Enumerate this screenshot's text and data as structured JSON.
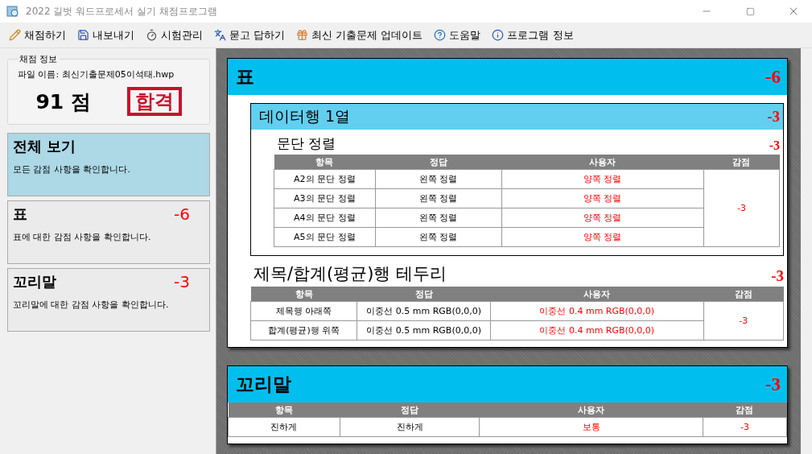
{
  "window": {
    "title": "2022 길벗 워드프로세서 실기 채점프로그램"
  },
  "menu": [
    {
      "label": "채점하기"
    },
    {
      "label": "내보내기"
    },
    {
      "label": "시험관리"
    },
    {
      "label": "묻고 답하기"
    },
    {
      "label": "최신 기출문제 업데이트"
    },
    {
      "label": "도움말"
    },
    {
      "label": "프로그램 정보"
    }
  ],
  "score_info": {
    "title": "채점 정보",
    "file_name": "파일 이름: 최신기출문제05이석태.hwp",
    "score": "91 점",
    "result": "합격"
  },
  "nav": [
    {
      "title": "전체 보기",
      "description": "모든 감점 사항을 확인합니다.",
      "selected": true
    },
    {
      "title": "표",
      "penalty": "-6",
      "description": "표에 대한 감점 사항을 확인합니다.",
      "selected": false
    },
    {
      "title": "꼬리말",
      "penalty": "-3",
      "description": "꼬리말에 대한 감점 사항을 확인합니다.",
      "selected": false
    }
  ],
  "sections": [
    {
      "title": "표",
      "penalty": "-6",
      "children": [
        {
          "kind": "subsection",
          "title": "데이터행 1열",
          "penalty": "-3",
          "children": [
            {
              "kind": "group",
              "title": "문단 정렬",
              "penalty": "-3",
              "table": {
                "columns": [
                  "항목",
                  "정답",
                  "사용자",
                  "감점"
                ],
                "deduction": "-3",
                "rows": [
                  {
                    "item": "A2의 문단 정렬",
                    "answer": "왼쪽 정렬",
                    "user": "양쪽 정렬"
                  },
                  {
                    "item": "A3의 문단 정렬",
                    "answer": "왼쪽 정렬",
                    "user": "양쪽 정렬"
                  },
                  {
                    "item": "A4의 문단 정렬",
                    "answer": "왼쪽 정렬",
                    "user": "양쪽 정렬"
                  },
                  {
                    "item": "A5의 문단 정렬",
                    "answer": "왼쪽 정렬",
                    "user": "양쪽 정렬"
                  }
                ]
              }
            }
          ]
        },
        {
          "kind": "group",
          "title": "제목/합계(평균)행 테두리",
          "penalty": "-3",
          "table": {
            "columns": [
              "항목",
              "정답",
              "사용자",
              "감점"
            ],
            "deduction": "-3",
            "rows": [
              {
                "item": "제목행 아래쪽",
                "answer": "이중선 0.5 mm RGB(0,0,0)",
                "user": "이중선 0.4 mm RGB(0,0,0)"
              },
              {
                "item": "합계(평균)행 위쪽",
                "answer": "이중선 0.5 mm RGB(0,0,0)",
                "user": "이중선 0.4 mm RGB(0,0,0)"
              }
            ]
          }
        }
      ]
    },
    {
      "title": "꼬리말",
      "penalty": "-3",
      "children": [
        {
          "kind": "table",
          "table": {
            "columns": [
              "항목",
              "정답",
              "사용자",
              "감점"
            ],
            "deduction": "-3",
            "rows": [
              {
                "item": "진하게",
                "answer": "진하게",
                "user": "보통"
              }
            ]
          }
        }
      ]
    }
  ]
}
